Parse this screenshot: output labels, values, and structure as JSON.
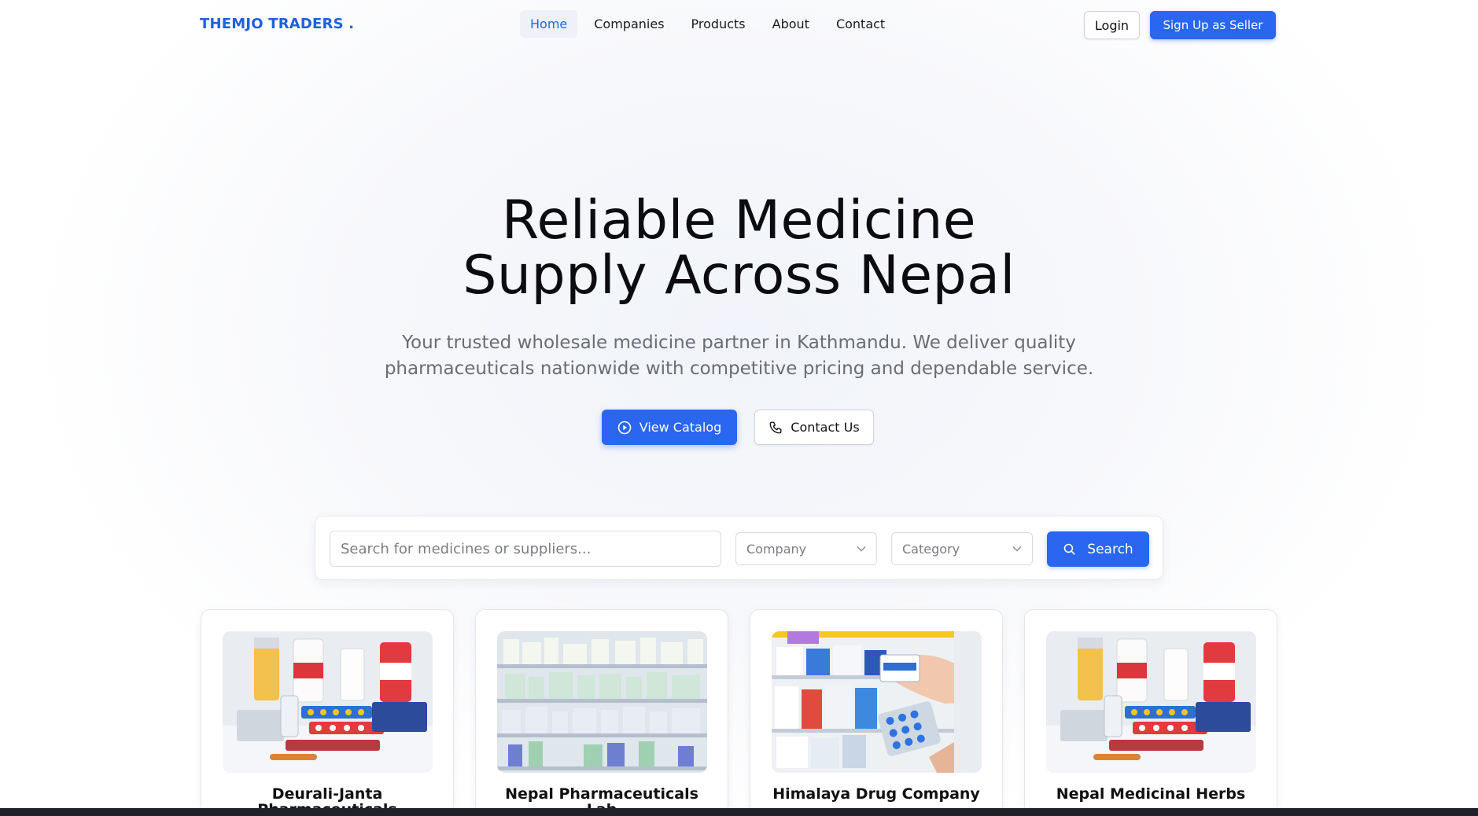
{
  "brand": {
    "name": "THEMJO TRADERS ."
  },
  "nav": {
    "links": [
      {
        "label": "Home"
      },
      {
        "label": "Companies"
      },
      {
        "label": "Products"
      },
      {
        "label": "About"
      },
      {
        "label": "Contact"
      }
    ],
    "login_label": "Login",
    "signup_label": "Sign Up as Seller"
  },
  "hero": {
    "title_line1": "Reliable Medicine",
    "title_line2": "Supply Across Nepal",
    "subtitle_line1": "Your trusted wholesale medicine partner in Kathmandu. We deliver quality",
    "subtitle_line2": "pharmaceuticals nationwide with competitive pricing and dependable service.",
    "catalog_label": "View Catalog",
    "contact_label": "Contact Us"
  },
  "search": {
    "placeholder": "Search for medicines or suppliers...",
    "company_placeholder": "Company",
    "category_placeholder": "Category",
    "button_label": "Search"
  },
  "companies": [
    {
      "name": "Deurali-Janta Pharmaceuticals",
      "image": "medicine-bottles-and-pill-packs"
    },
    {
      "name": "Nepal Pharmaceuticals Lab",
      "image": "pharmacy-shelves"
    },
    {
      "name": "Himalaya Drug Company",
      "image": "hand-picking-medicine-boxes"
    },
    {
      "name": "Nepal Medicinal Herbs",
      "image": "medicine-bottles-and-pill-packs"
    }
  ],
  "colors": {
    "accent": "#2a66f0",
    "brand_text": "#2060e0",
    "nav_active_bg": "#eef1f7"
  }
}
